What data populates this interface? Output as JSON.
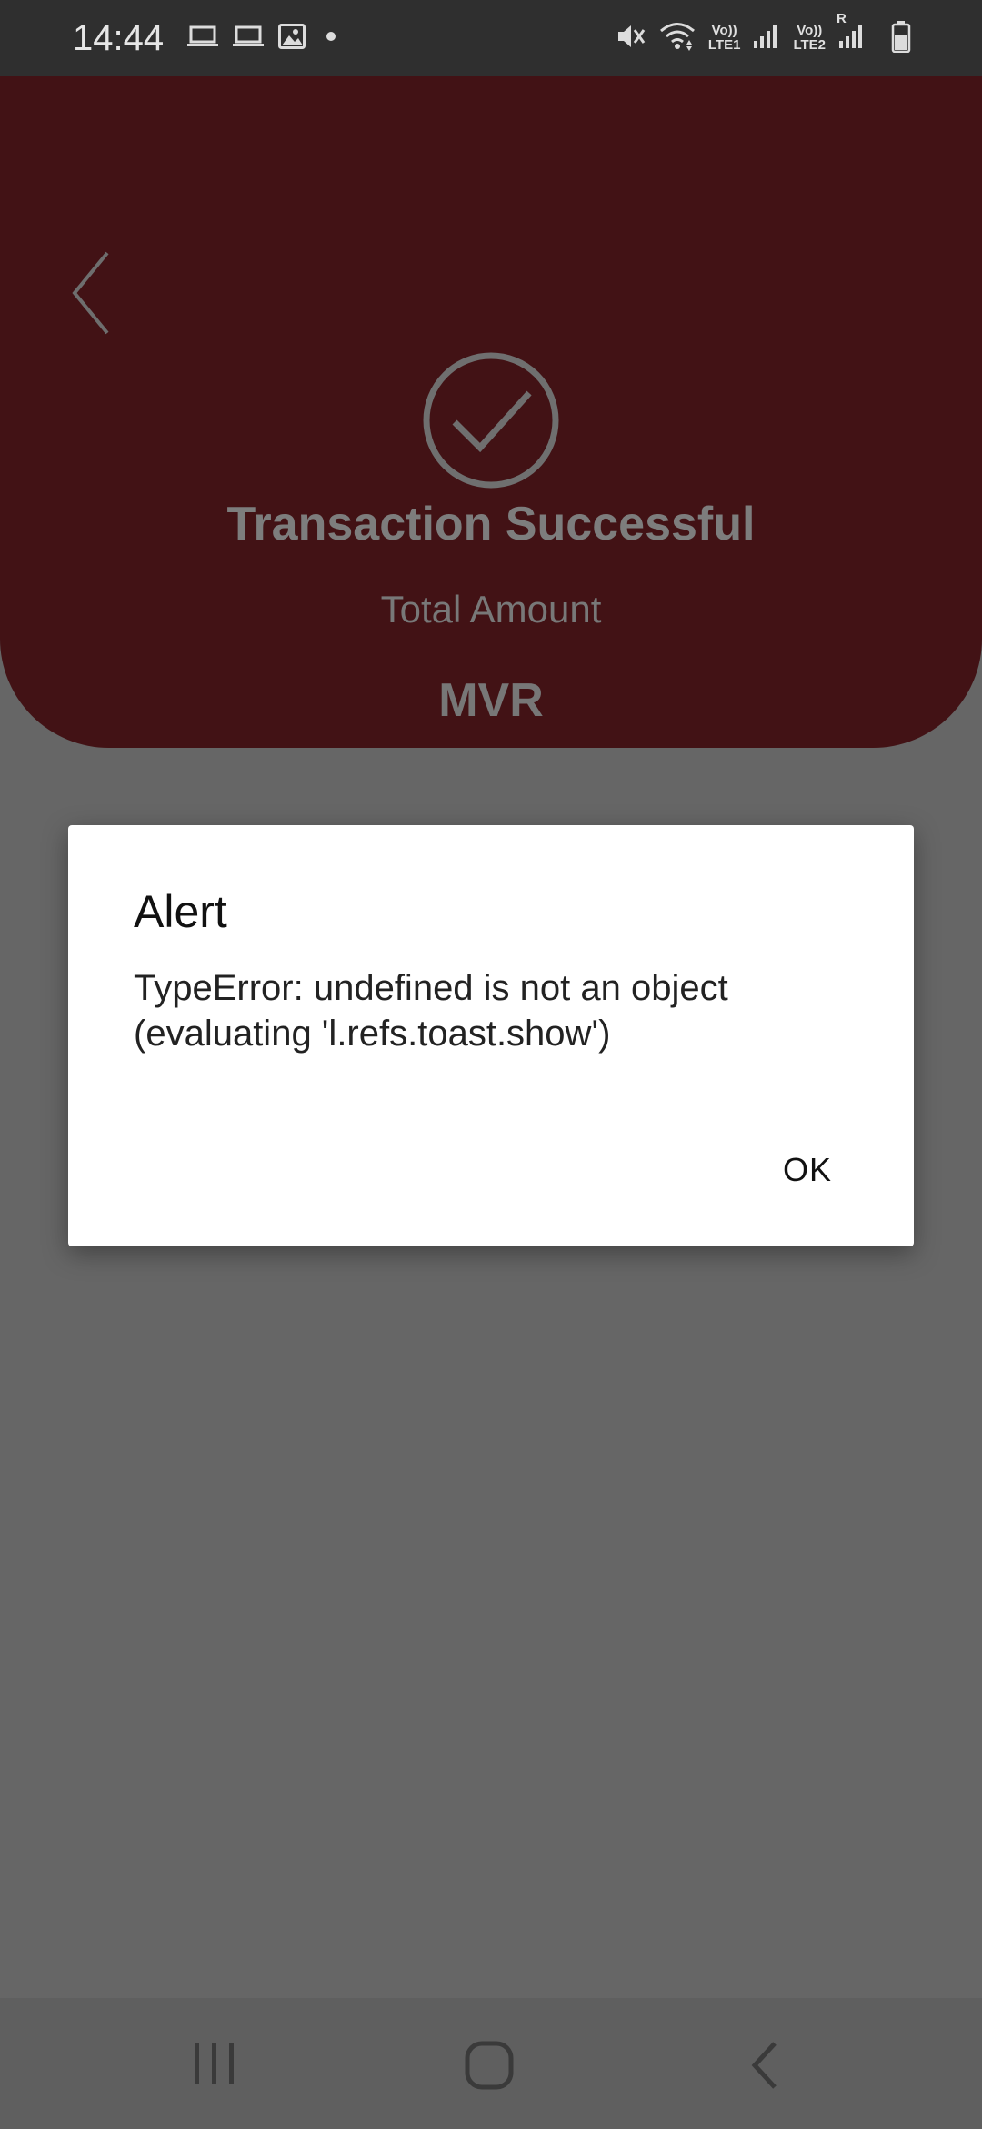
{
  "status_bar": {
    "time": "14:44",
    "left_icons": [
      "laptop-icon",
      "laptop-icon",
      "image-icon",
      "dot-icon"
    ],
    "right_icons": [
      "mute-icon",
      "wifi-icon",
      "signal-icon",
      "signal-icon",
      "battery-icon"
    ],
    "sim1_label_top": "Vo))",
    "sim1_label_bottom": "LTE1",
    "sim2_label_top": "Vo))",
    "sim2_label_bottom": "LTE2",
    "roaming_label": "R"
  },
  "header": {
    "title": "Transaction Successful",
    "amount_label": "Total Amount",
    "currency": "MVR",
    "background_color": "#421215"
  },
  "dialog": {
    "title": "Alert",
    "message": "TypeError: undefined is not an object (evaluating 'l.refs.toast.show')",
    "ok_label": "OK"
  },
  "nav_bar": {
    "icons": [
      "recent-apps-icon",
      "home-icon",
      "back-icon"
    ]
  }
}
